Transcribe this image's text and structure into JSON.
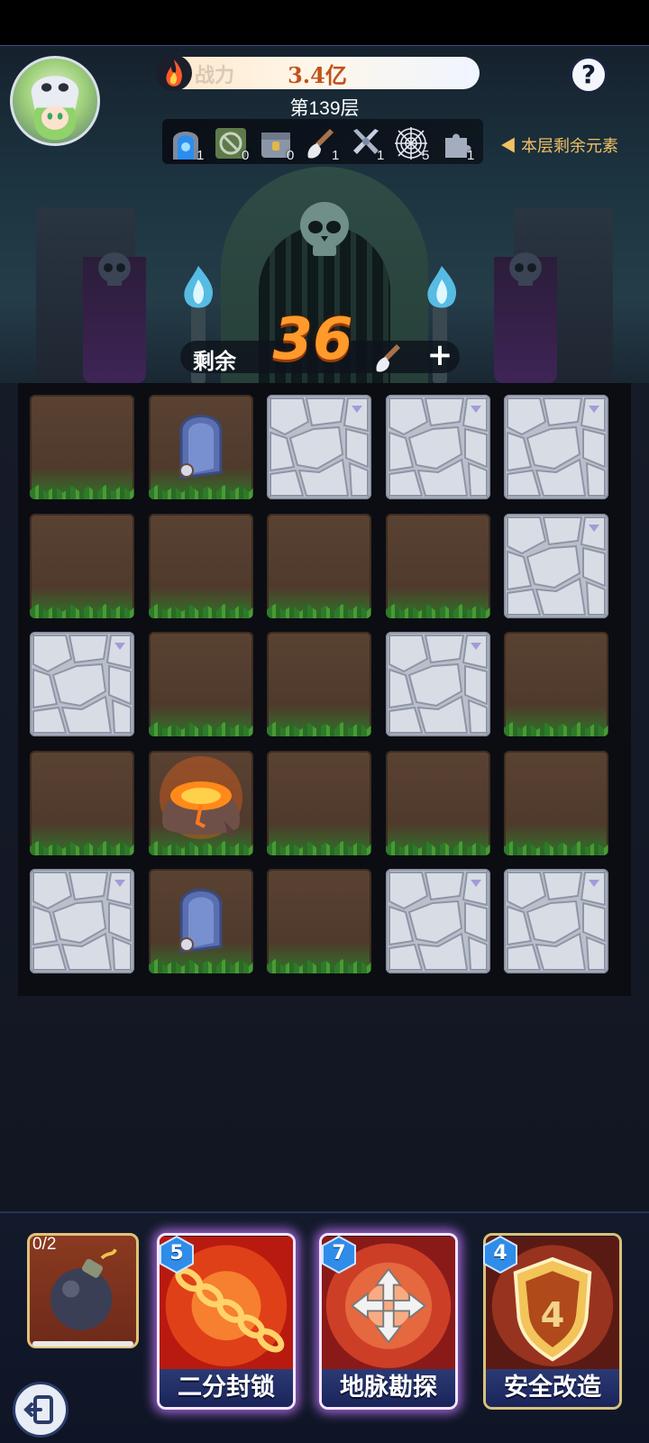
{
  "header": {
    "power_label": "战力",
    "power_value": "3.4亿",
    "floor_label": "第139层",
    "help_label": "?"
  },
  "elements": {
    "hint": "◀ 本层剩余元素",
    "items": [
      {
        "icon": "portal-icon",
        "count": "1"
      },
      {
        "icon": "blocked-icon",
        "count": "0"
      },
      {
        "icon": "locked-chest-icon",
        "count": "0"
      },
      {
        "icon": "shovel-icon",
        "count": "1"
      },
      {
        "icon": "crossed-swords-icon",
        "count": "1"
      },
      {
        "icon": "spider-web-icon",
        "count": "5"
      },
      {
        "icon": "puzzle-piece-icon",
        "count": "1"
      }
    ]
  },
  "remaining": {
    "label": "剩余",
    "value": "36",
    "plus_label": "+"
  },
  "grid": {
    "rows": [
      [
        "dirt",
        "tombstone",
        "stone",
        "stone",
        "stone"
      ],
      [
        "dirt",
        "dirt",
        "dirt",
        "dirt",
        "stone"
      ],
      [
        "stone",
        "dirt",
        "dirt",
        "stone",
        "dirt"
      ],
      [
        "dirt",
        "lava-pot",
        "dirt",
        "dirt",
        "dirt"
      ],
      [
        "stone",
        "tombstone",
        "dirt",
        "stone",
        "stone"
      ]
    ]
  },
  "cards": {
    "bomb": {
      "count": "0/2",
      "progress": 0
    },
    "skills": [
      {
        "name": "二分封锁",
        "cost": "5",
        "icon": "chain-icon",
        "active": true
      },
      {
        "name": "地脉勘探",
        "cost": "7",
        "icon": "arrows-cross-icon",
        "active": true
      },
      {
        "name": "安全改造",
        "cost": "4",
        "icon": "shield-icon",
        "active": false
      }
    ]
  },
  "colors": {
    "accent_orange": "#ff9a2b",
    "hint_gold": "#f1c064",
    "card_name_bg": "#1a245a",
    "active_glow": "#c478ff"
  }
}
